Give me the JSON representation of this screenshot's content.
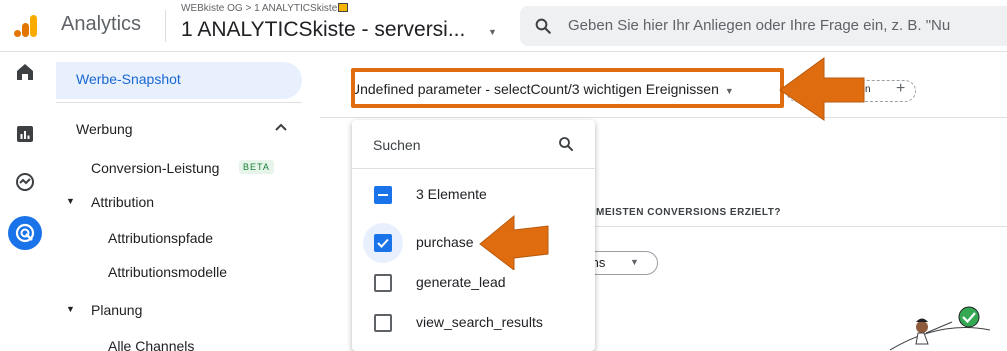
{
  "header": {
    "app_title": "Analytics",
    "account_crumb": "WEBkiste OG > 1 ANALYTICSkiste",
    "property_name": "1 ANALYTICSkiste - serversi...",
    "search_placeholder": "Geben Sie hier Ihr Anliegen oder Ihre Frage ein, z. B. \"Nu"
  },
  "rail": {
    "icons": [
      "home-icon",
      "reports-icon",
      "explore-icon",
      "advertising-icon"
    ],
    "active": "advertising-icon"
  },
  "sidenav": {
    "active_item": "Werbe-Snapshot",
    "section": "Werbung",
    "conversion": "Conversion-Leistung",
    "beta": "BETA",
    "attribution": "Attribution",
    "attribution_paths": "Attributionspfade",
    "attribution_models": "Attributionsmodelle",
    "planning": "Planung",
    "all_channels": "Alle Channels"
  },
  "main": {
    "event_selector": "Undefined parameter - selectCount/3 wichtigen Ereignissen",
    "compare_label": "ufügen",
    "card_title": "MEISTEN CONVERSIONS ERZIELT?",
    "metric_label": "sions"
  },
  "dropdown": {
    "search_label": "Suchen",
    "select_all": "3 Elemente",
    "items": [
      {
        "label": "purchase",
        "checked": true
      },
      {
        "label": "generate_lead",
        "checked": false
      },
      {
        "label": "view_search_results",
        "checked": false
      }
    ]
  },
  "colors": {
    "accent": "#1a73e8",
    "annotation": "#e06c10"
  }
}
